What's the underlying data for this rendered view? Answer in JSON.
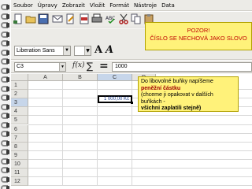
{
  "menu": [
    "Soubor",
    "Úpravy",
    "Zobrazit",
    "Vložit",
    "Formát",
    "Nástroje",
    "Data"
  ],
  "toolbar": {
    "font_name": "Liberation Sans",
    "cell_ref": "C3",
    "formula_value": "1000"
  },
  "sheet": {
    "columns": [
      "A",
      "B",
      "C",
      "D"
    ],
    "rows": [
      "1",
      "2",
      "3",
      "4",
      "5",
      "6",
      "7",
      "8",
      "9",
      "10",
      "11",
      "12"
    ],
    "active_cell_text": "1 000,00 Kč",
    "selected_column": "C",
    "selected_row": "3"
  },
  "callout_warning": {
    "line1": "POZOR!",
    "line2": "ČÍSLO SE NECHOVÁ JAKO SLOVO"
  },
  "callout_instruction": {
    "line1": "Do libovolné buňky napíšeme",
    "line2": "peněžní částku",
    "line3": "(chceme ji opakovat v dalších buňkách -",
    "line4": "všichni zaplatili stejně)"
  },
  "colors": {
    "callout_bg": "#fff27a",
    "warning_text": "#c00000",
    "selection_header": "#c7d6ea"
  }
}
